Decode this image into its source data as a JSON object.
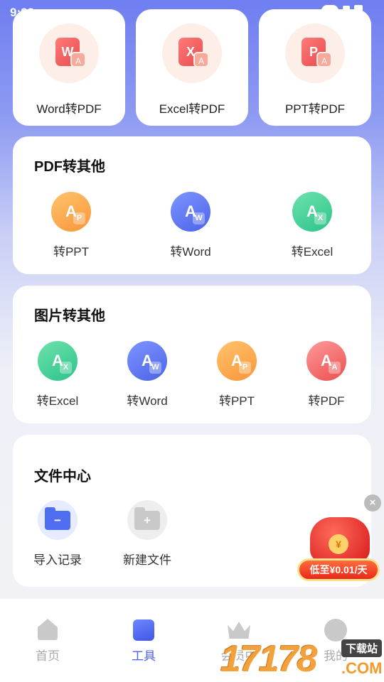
{
  "status_bar": {
    "time": "9:23"
  },
  "top_cards": [
    {
      "letter": "W",
      "label": "Word转PDF"
    },
    {
      "letter": "X",
      "label": "Excel转PDF"
    },
    {
      "letter": "P",
      "label": "PPT转PDF"
    }
  ],
  "pdf_section": {
    "title": "PDF转其他",
    "items": [
      {
        "label": "转PPT",
        "badge": "P",
        "color": "#f99537",
        "icon": "pdf-to-ppt-icon"
      },
      {
        "label": "转Word",
        "badge": "W",
        "color": "#4c63e8",
        "icon": "pdf-to-word-icon"
      },
      {
        "label": "转Excel",
        "badge": "X",
        "color": "#2cc38a",
        "icon": "pdf-to-excel-icon"
      }
    ]
  },
  "image_section": {
    "title": "图片转其他",
    "items": [
      {
        "label": "转Excel",
        "badge": "X",
        "color": "#2cc38a",
        "icon": "image-to-excel-icon"
      },
      {
        "label": "转Word",
        "badge": "W",
        "color": "#4c63e8",
        "icon": "image-to-word-icon"
      },
      {
        "label": "转PPT",
        "badge": "P",
        "color": "#f99537",
        "icon": "image-to-ppt-icon"
      },
      {
        "label": "转PDF",
        "badge": "A",
        "color": "#ea4f4f",
        "icon": "image-to-pdf-icon"
      }
    ]
  },
  "file_center": {
    "title": "文件中心",
    "items": [
      {
        "label": "导入记录",
        "icon": "folder-icon"
      },
      {
        "label": "新建文件",
        "icon": "add-folder-icon"
      }
    ]
  },
  "promo": {
    "text": "低至¥0.01/天",
    "close": "×",
    "coin": "¥"
  },
  "bottom_nav": [
    {
      "label": "首页",
      "icon": "home-icon",
      "active": false
    },
    {
      "label": "工具",
      "icon": "tools-cube-icon",
      "active": true
    },
    {
      "label": "会员中",
      "icon": "crown-icon",
      "active": false
    },
    {
      "label": "我的",
      "icon": "profile-icon",
      "active": false
    }
  ],
  "watermark": {
    "number": "17178",
    "tag": "下载站",
    "domain": ".COM"
  }
}
